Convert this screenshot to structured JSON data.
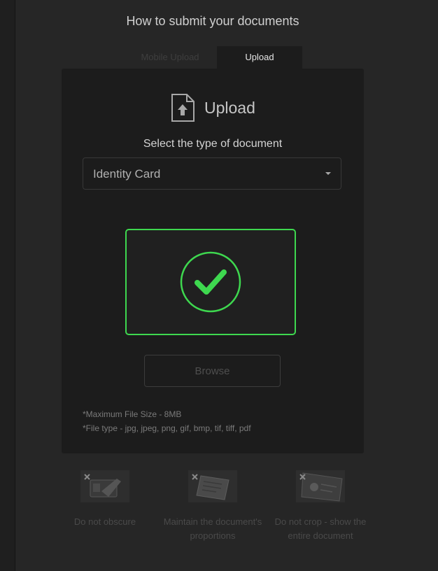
{
  "heading": "How to submit your documents",
  "tabs": [
    {
      "label": "Mobile Upload",
      "active": false
    },
    {
      "label": "Upload",
      "active": true
    }
  ],
  "upload": {
    "title": "Upload",
    "icon": "file-upload-icon",
    "select_label": "Select the type of document",
    "document_type": "Identity Card",
    "dropzone_icon": "check-circle-icon",
    "browse_label": "Browse",
    "notes": [
      "*Maximum File Size - 8MB",
      "*File type - jpg, jpeg, png, gif, bmp, tif, tiff, pdf"
    ]
  },
  "tips": [
    {
      "text": "Do not obscure",
      "icon": "obscured-card-image"
    },
    {
      "text": "Maintain the document's proportions",
      "icon": "skewed-document-image"
    },
    {
      "text": "Do not crop - show the entire document",
      "icon": "cropped-document-image"
    }
  ],
  "colors": {
    "accent_green": "#3ed84f",
    "background": "#262626",
    "card": "#1c1c1c"
  }
}
